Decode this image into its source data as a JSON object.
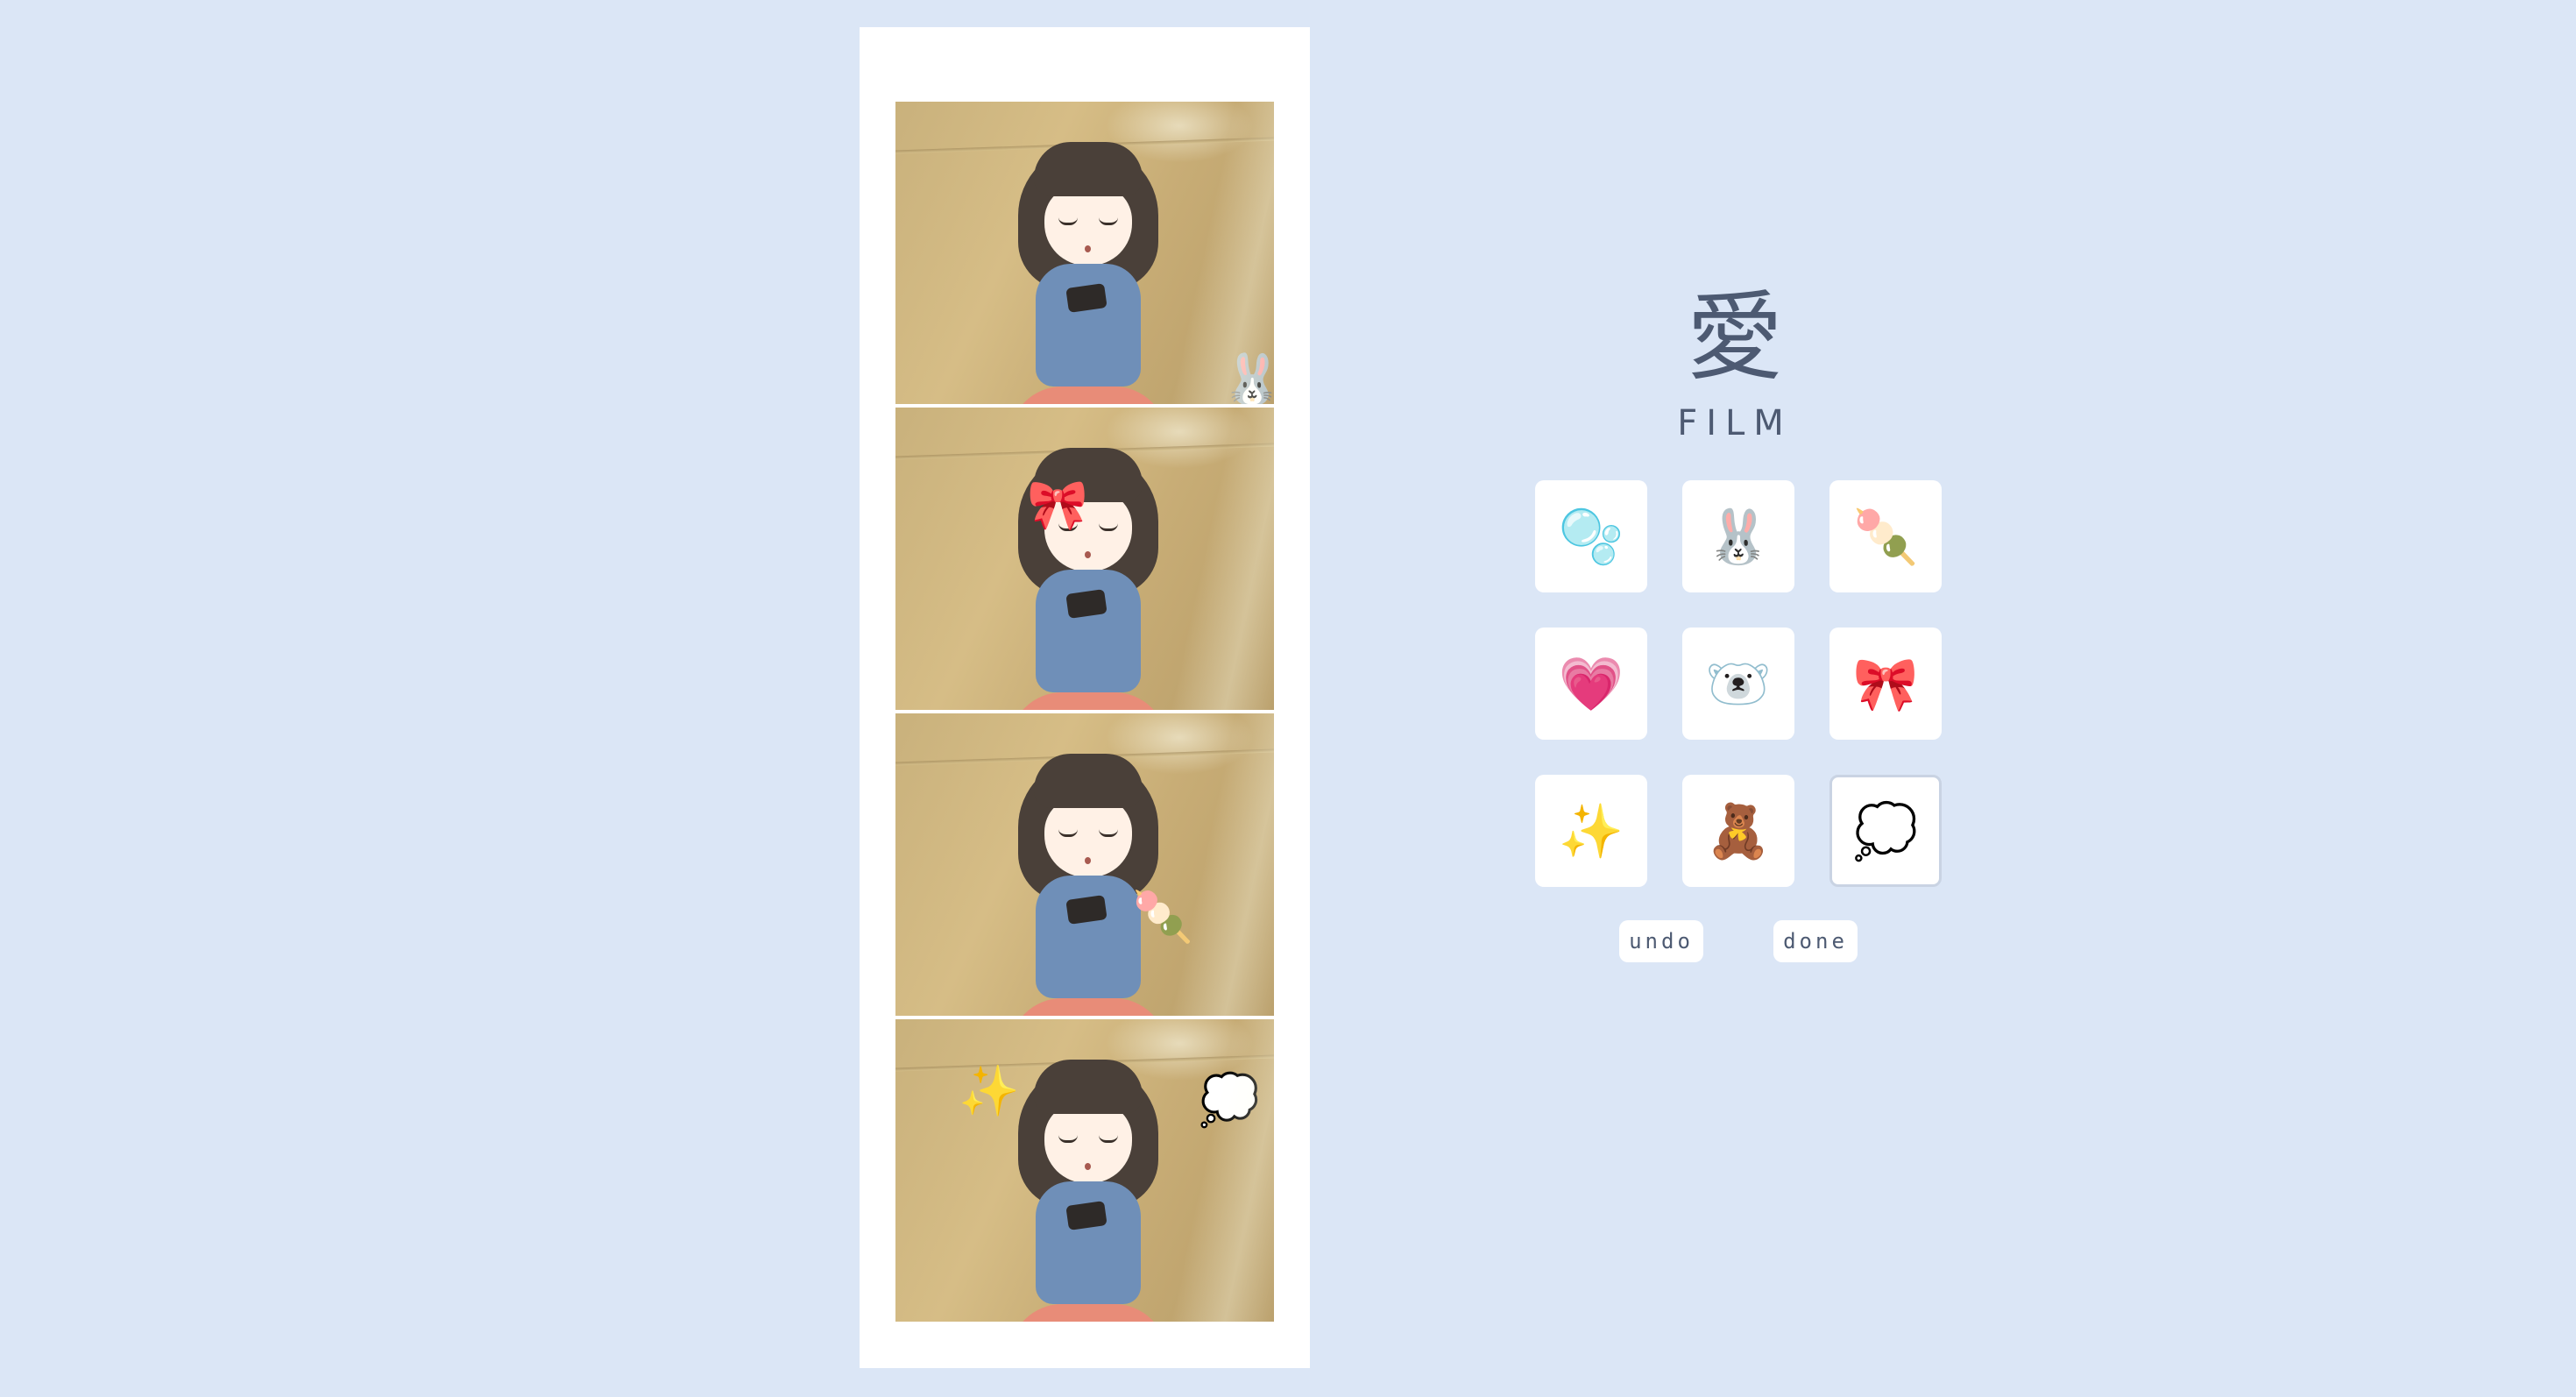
{
  "logo": {
    "kanji": "愛",
    "title": "FILM"
  },
  "stickers": [
    {
      "name": "bubbles",
      "glyph": "🫧"
    },
    {
      "name": "bunny",
      "glyph": "🐰"
    },
    {
      "name": "dango",
      "glyph": "🍡"
    },
    {
      "name": "heart",
      "glyph": "💗"
    },
    {
      "name": "polar-bear",
      "glyph": "🐻‍❄️"
    },
    {
      "name": "ribbon",
      "glyph": "🎀"
    },
    {
      "name": "sparkles",
      "glyph": "✨"
    },
    {
      "name": "teddy-bear",
      "glyph": "🧸"
    },
    {
      "name": "heart-thought",
      "glyph": "💭"
    }
  ],
  "selected_sticker": "heart-thought",
  "placed": {
    "frame1": "🐰",
    "frame2": "🎀",
    "frame3": "🍡",
    "frame4a": "✨",
    "frame4b": "💭"
  },
  "buttons": {
    "undo": "undo",
    "done": "done"
  },
  "colors": {
    "background": "#dbe6f6",
    "strip": "#ffffff",
    "accent_text": "#4d5a72"
  }
}
